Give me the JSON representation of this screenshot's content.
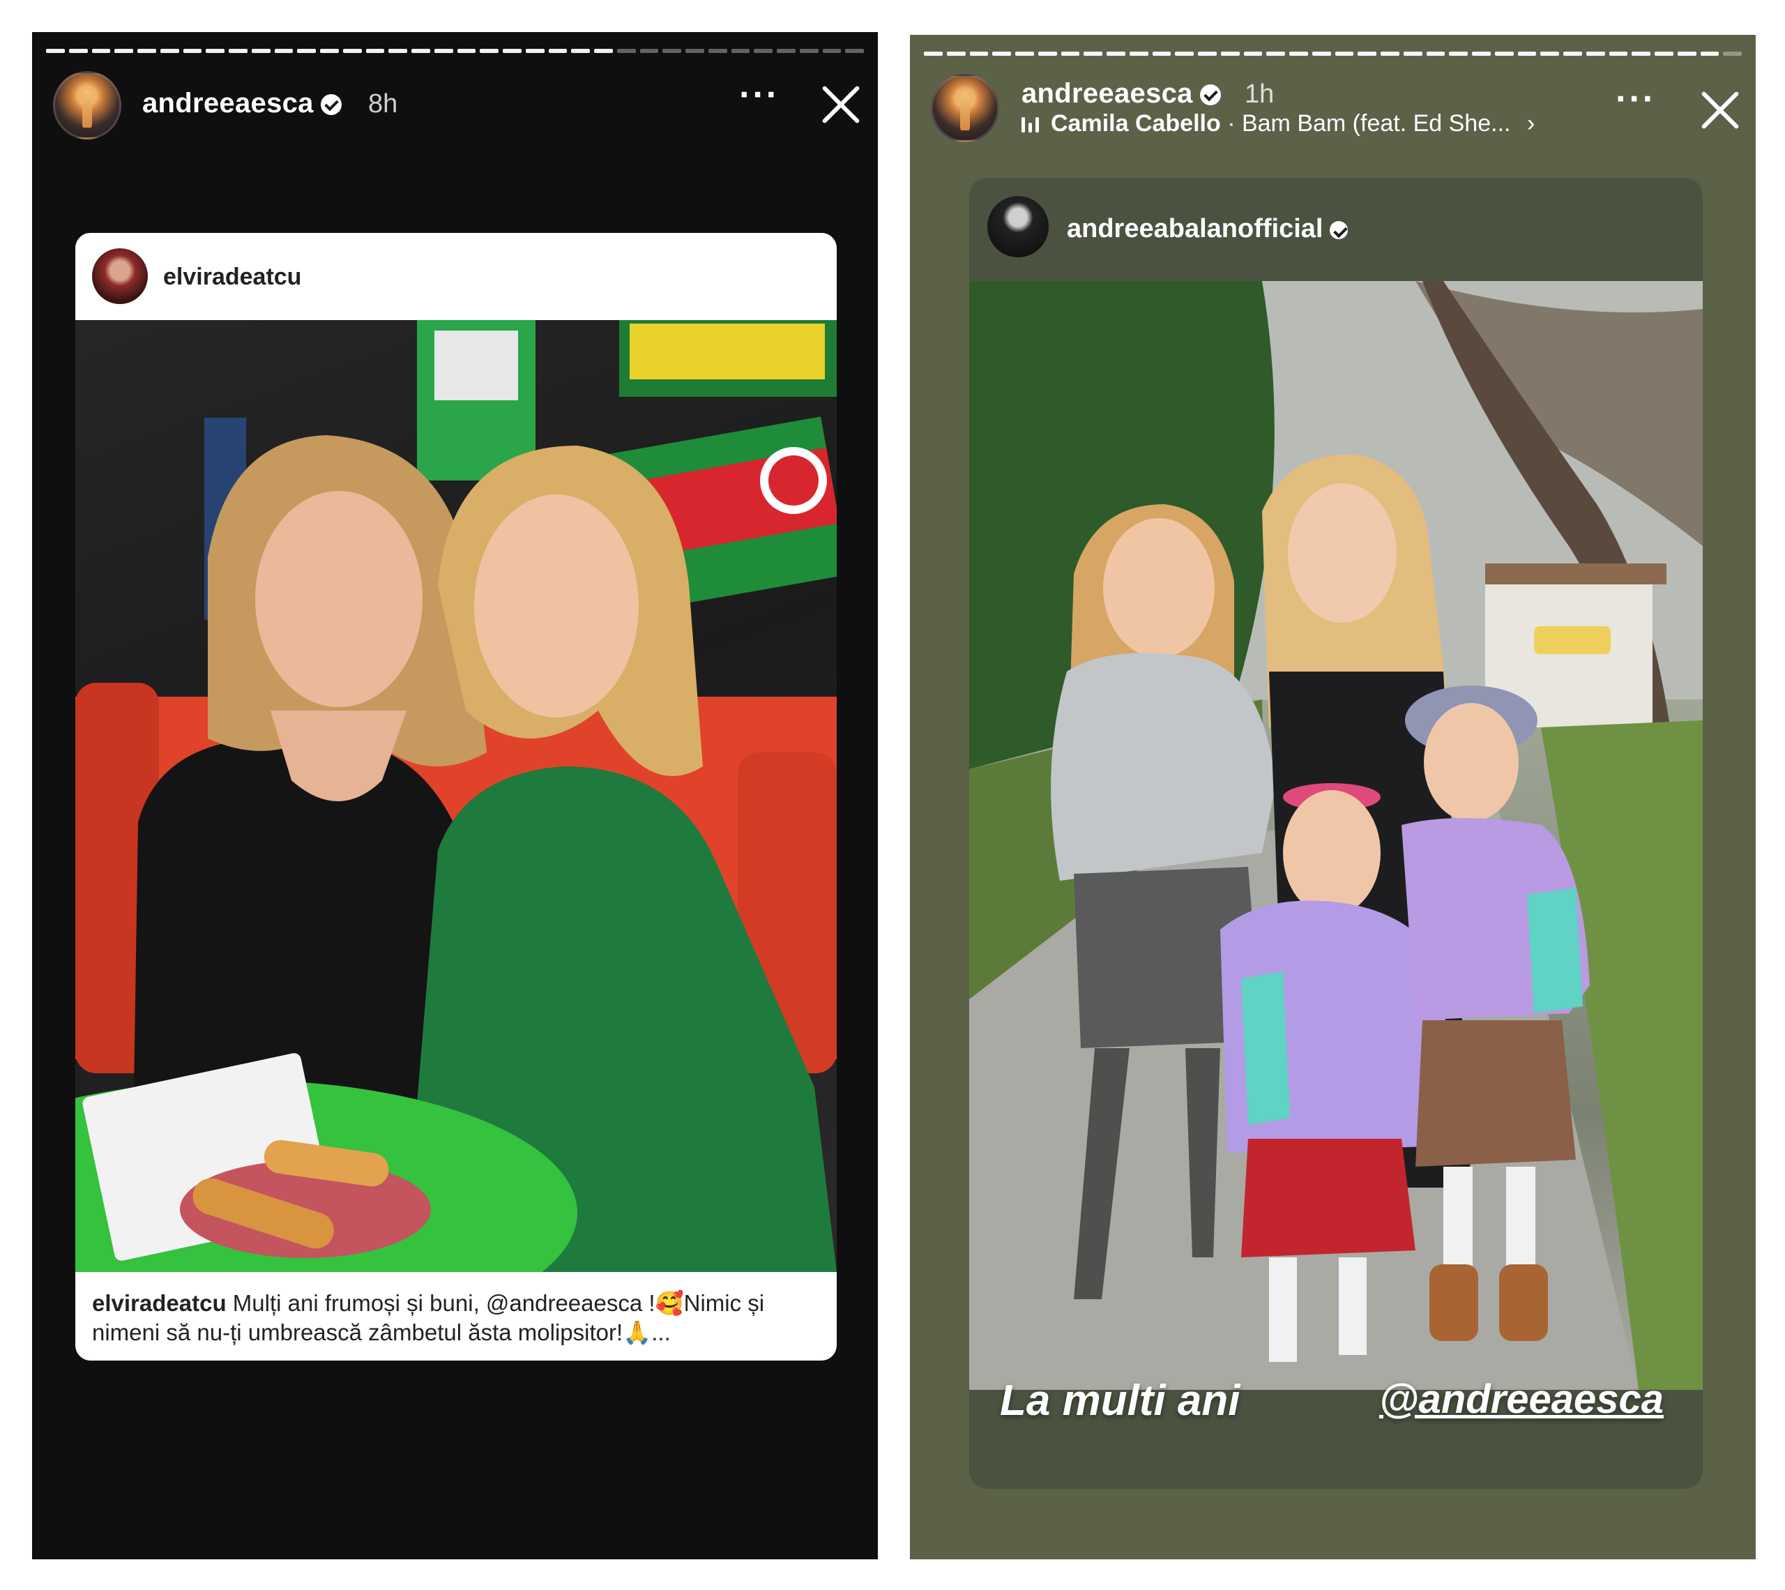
{
  "stories": [
    {
      "user": {
        "username": "andreeaesca",
        "verified": true,
        "time": "8h"
      },
      "menu_icon": "more-horizontal-icon",
      "close_icon": "close-icon",
      "shared_post": {
        "username": "elviradeatcu",
        "caption_user": "elviradeatcu",
        "caption_text": "Mulți ani frumoși și buni, @andreeaesca !🥰Nimic și nimeni să nu-ți umbrească zâmbetul ăsta molipsitor!🙏..."
      }
    },
    {
      "user": {
        "username": "andreeaesca",
        "verified": true,
        "time": "1h"
      },
      "music": {
        "artist": "Camila Cabello",
        "track": "· Bam Bam (feat. Ed She...",
        "chevron": "›"
      },
      "menu_icon": "more-horizontal-icon",
      "close_icon": "close-icon",
      "shared_post": {
        "username": "andreeabalanofficial",
        "verified": true
      },
      "overlay": {
        "text": "La multi ani",
        "mention": "@andreeaesca"
      }
    }
  ],
  "colors": {
    "left_bg": "#0f0f10",
    "right_bg": "#5b6248",
    "card_right": "#4b5340"
  }
}
